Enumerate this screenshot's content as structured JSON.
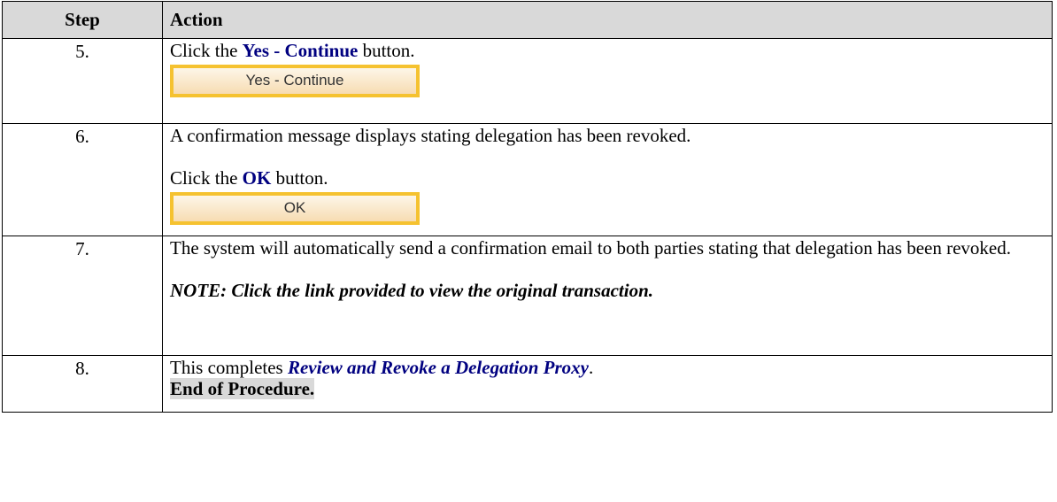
{
  "header": {
    "step": "Step",
    "action": "Action"
  },
  "rows": [
    {
      "step": "5.",
      "text_before": "Click the ",
      "highlight": "Yes - Continue",
      "text_after": " button.",
      "button_label": "Yes - Continue"
    },
    {
      "step": "6.",
      "message": "A confirmation message displays stating delegation has been revoked.",
      "text_before": "Click the ",
      "highlight": "OK",
      "text_after": " button.",
      "button_label": "OK"
    },
    {
      "step": "7.",
      "message": "The system will automatically send a confirmation email to both parties stating that delegation has been revoked.",
      "note": "NOTE: Click the link provided to view the original transaction."
    },
    {
      "step": "8.",
      "text_before": "This completes ",
      "highlight": "Review and Revoke a Delegation Proxy",
      "text_after": ".",
      "end_text": "End of Procedure."
    }
  ],
  "colors": {
    "highlight": "#000080",
    "button_border": "#f5c230",
    "header_bg": "#d9d9d9"
  }
}
